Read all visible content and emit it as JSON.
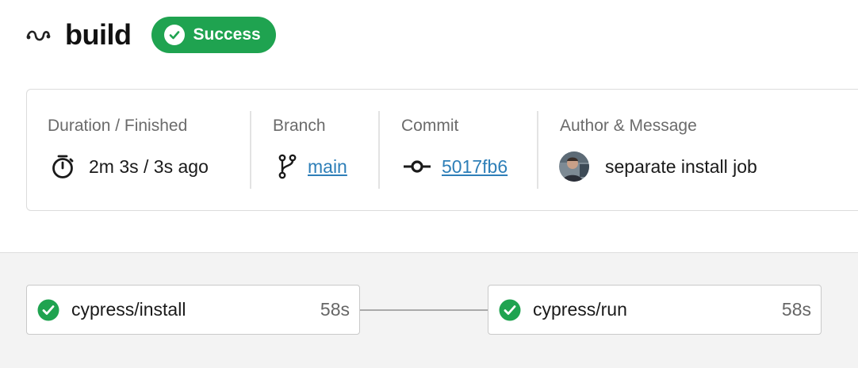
{
  "header": {
    "title": "build",
    "status": "Success",
    "icon": "workflow-icon"
  },
  "colors": {
    "success": "#1fa350",
    "link": "#2e7fb8"
  },
  "summary": {
    "duration": {
      "label": "Duration / Finished",
      "value": "2m 3s / 3s ago",
      "icon": "stopwatch-icon"
    },
    "branch": {
      "label": "Branch",
      "value": "main",
      "icon": "git-branch-icon"
    },
    "commit": {
      "label": "Commit",
      "value": "5017fb6",
      "icon": "git-commit-icon"
    },
    "author": {
      "label": "Author & Message",
      "message": "separate install job",
      "icon": "avatar"
    }
  },
  "jobs": [
    {
      "name": "cypress/install",
      "duration": "58s",
      "status": "success"
    },
    {
      "name": "cypress/run",
      "duration": "58s",
      "status": "success"
    }
  ]
}
